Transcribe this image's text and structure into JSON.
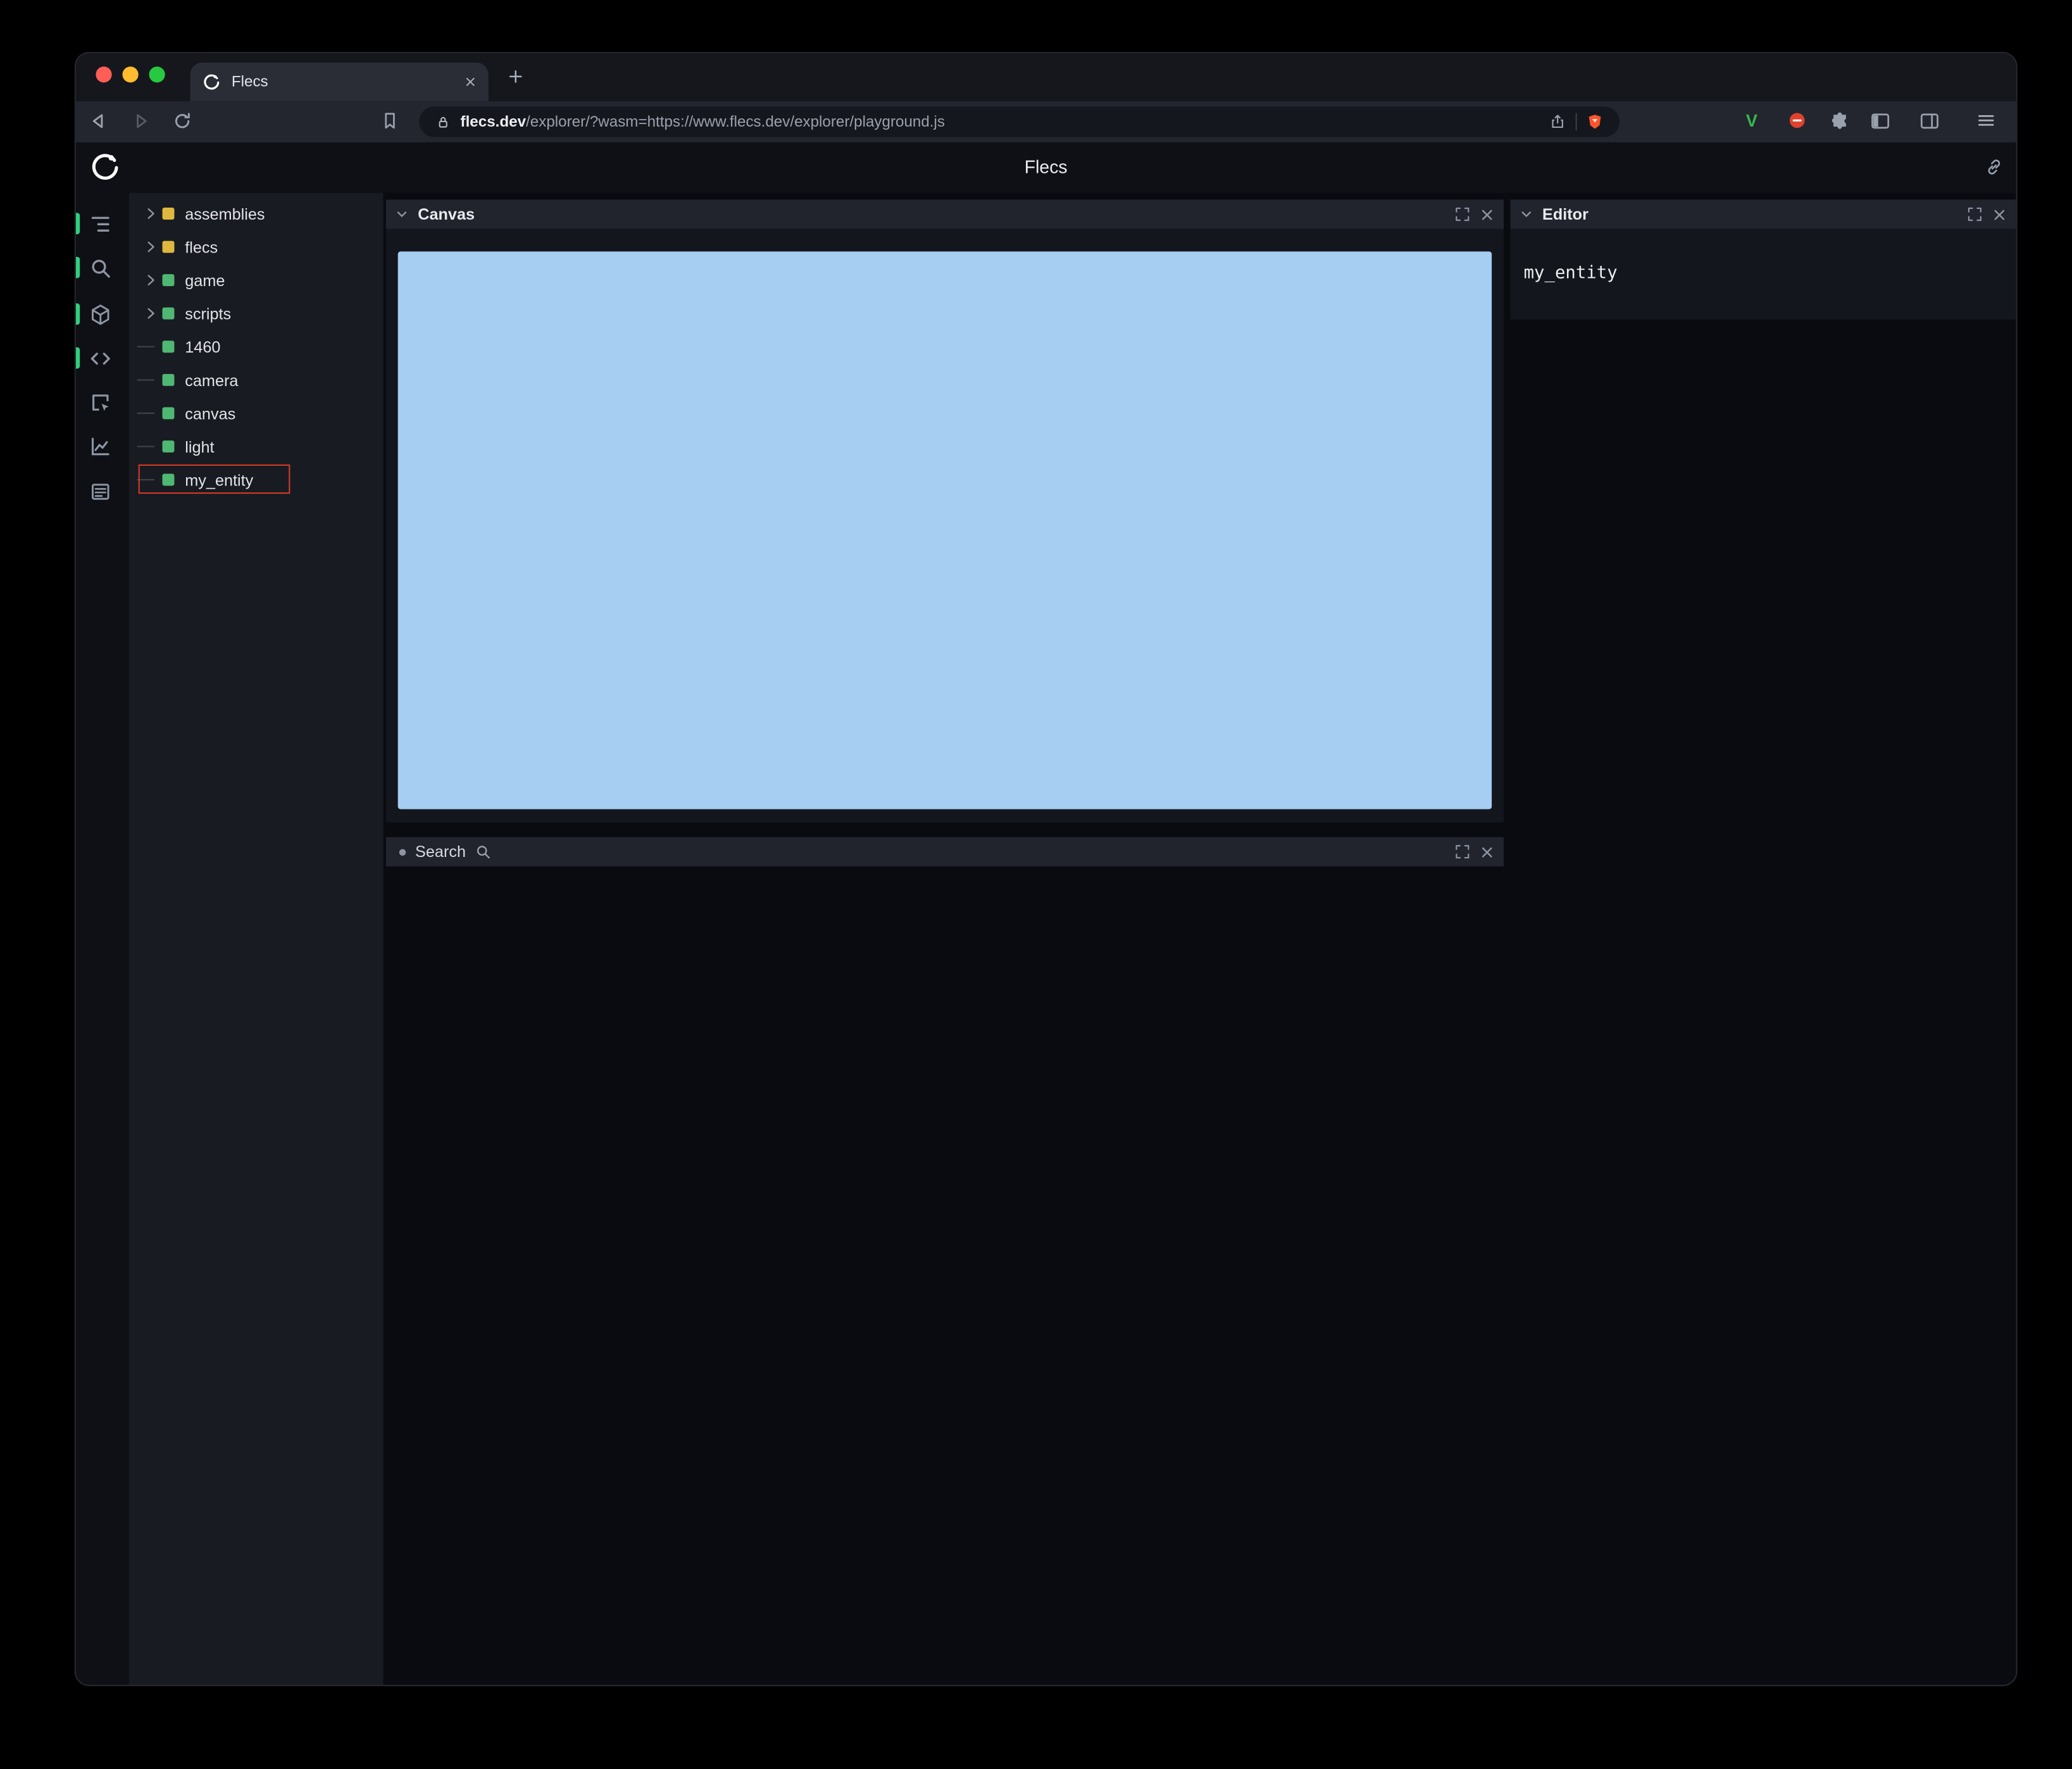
{
  "browser": {
    "traffic_lights": {
      "close": "#ff5f57",
      "minimize": "#febc2e",
      "zoom": "#28c840"
    },
    "tab": {
      "title": "Flecs"
    },
    "url_domain": "flecs.dev",
    "url_path": "/explorer/?wasm=https://www.flecs.dev/explorer/playground.js"
  },
  "app": {
    "header": {
      "title": "Flecs"
    },
    "rail_items": [
      "entity-tree-icon",
      "search-icon",
      "cube-icon",
      "code-icon",
      "inspect-icon",
      "chart-icon",
      "console-icon"
    ],
    "tree": {
      "items": [
        {
          "label": "assemblies",
          "color": "#dfb93f",
          "expandable": true
        },
        {
          "label": "flecs",
          "color": "#dfb93f",
          "expandable": true
        },
        {
          "label": "game",
          "color": "#4fb873",
          "expandable": true
        },
        {
          "label": "scripts",
          "color": "#4fb873",
          "expandable": true
        },
        {
          "label": "1460",
          "color": "#4fb873",
          "expandable": false
        },
        {
          "label": "camera",
          "color": "#4fb873",
          "expandable": false
        },
        {
          "label": "canvas",
          "color": "#4fb873",
          "expandable": false
        },
        {
          "label": "light",
          "color": "#4fb873",
          "expandable": false
        },
        {
          "label": "my_entity",
          "color": "#4fb873",
          "expandable": false,
          "annotated": true
        }
      ]
    },
    "panels": {
      "canvas": {
        "title": "Canvas",
        "surface_color": "#a6cdf2"
      },
      "search": {
        "title": "Search"
      },
      "editor": {
        "title": "Editor",
        "content": "my_entity"
      }
    },
    "annotation_color": "#d23b27",
    "active_indicator_color": "#2fd07c"
  }
}
